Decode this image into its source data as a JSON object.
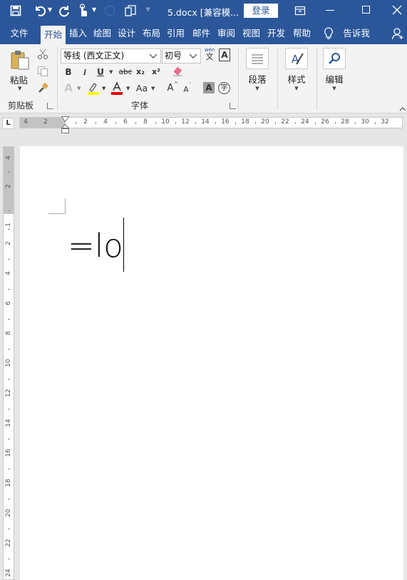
{
  "titlebar": {
    "filename": "5.docx [兼容模...",
    "login_label": "登录"
  },
  "tabs": [
    {
      "label": "文件"
    },
    {
      "label": "开始"
    },
    {
      "label": "插入"
    },
    {
      "label": "绘图"
    },
    {
      "label": "设计"
    },
    {
      "label": "布局"
    },
    {
      "label": "引用"
    },
    {
      "label": "邮件"
    },
    {
      "label": "审阅"
    },
    {
      "label": "视图"
    },
    {
      "label": "开发"
    },
    {
      "label": "帮助"
    }
  ],
  "tell_me": "告诉我",
  "ribbon": {
    "clipboard": {
      "paste_label": "粘贴",
      "group_label": "剪贴板"
    },
    "font": {
      "font_name": "等线 (西文正文)",
      "font_size": "初号",
      "bold": "B",
      "italic": "I",
      "underline": "U",
      "strikethrough": "abc",
      "subscript": "x₂",
      "superscript": "x²",
      "group_label": "字体",
      "change_case": "Aa",
      "grow_font": "A",
      "shrink_font": "A",
      "char_shading": "A",
      "enclose_char": "字",
      "phonetic_top": "wén",
      "phonetic_bottom": "文"
    },
    "paragraph_label": "段落",
    "styles_label": "样式",
    "editing_label": "编辑"
  },
  "ruler": {
    "corner": "L",
    "left_numbers": [
      "4",
      "2"
    ],
    "numbers": [
      "2",
      "4",
      "6",
      "8",
      "10",
      "12",
      "14",
      "16",
      "18",
      "20",
      "22",
      "24",
      "26",
      "28",
      "30",
      "32"
    ],
    "vertical_numbers": [
      "4",
      "2",
      "1",
      "2",
      "4",
      "6",
      "8",
      "10",
      "12",
      "14",
      "16",
      "18",
      "20",
      "22",
      "24"
    ]
  },
  "document": {
    "text": "=lo"
  }
}
